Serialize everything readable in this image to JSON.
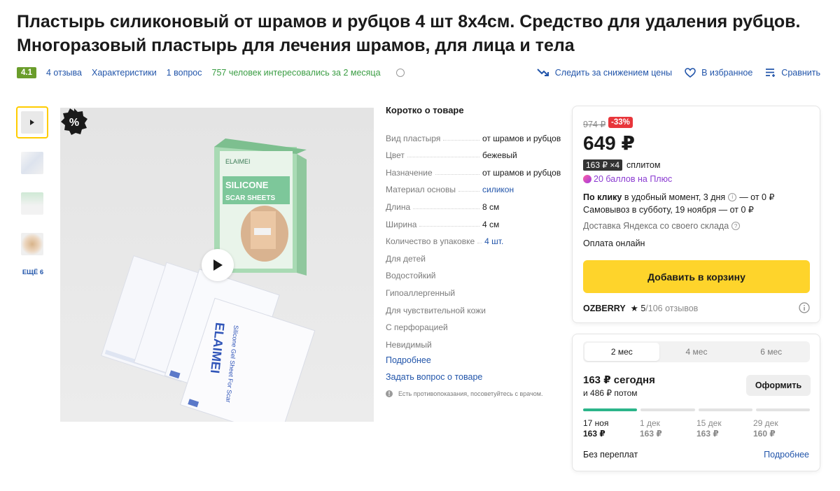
{
  "product": {
    "title": "Пластырь силиконовый от шрамов и рубцов 4 шт 8х4см. Средство для удаления рубцов. Многоразовый пластырь для лечения шрамов, для лица и тела"
  },
  "meta": {
    "rating": "4.1",
    "reviews": "4 отзыва",
    "characteristics": "Характеристики",
    "questions": "1 вопрос",
    "interest": "757 человек интересовались за 2 месяца"
  },
  "actions": {
    "track_price": "Следить за снижением цены",
    "favorite": "В избранное",
    "compare": "Сравнить"
  },
  "gallery": {
    "more": "ЕЩЁ 6",
    "box_brand": "ELAIMEI",
    "box_title_1": "SILICONE",
    "box_title_2": "SCAR SHEETS",
    "packet_brand": "ELAIMEI",
    "packet_text": "Silicone Gel Sheet For Scar",
    "discount_symbol": "%"
  },
  "specs": {
    "title": "Коротко о товаре",
    "rows": [
      {
        "k": "Вид пластыря",
        "v": "от шрамов и рубцов",
        "link": false
      },
      {
        "k": "Цвет",
        "v": "бежевый",
        "link": false
      },
      {
        "k": "Назначение",
        "v": "от шрамов и рубцов",
        "link": false
      },
      {
        "k": "Материал основы",
        "v": "силикон",
        "link": true
      },
      {
        "k": "Длина",
        "v": "8 см",
        "link": false
      },
      {
        "k": "Ширина",
        "v": "4 см",
        "link": false
      },
      {
        "k": "Количество в упаковке",
        "v": "4 шт.",
        "link": true
      },
      {
        "k": "Для детей",
        "v": "",
        "link": false
      },
      {
        "k": "Водостойкий",
        "v": "",
        "link": false
      },
      {
        "k": "Гипоаллергенный",
        "v": "",
        "link": false
      },
      {
        "k": "Для чувствительной кожи",
        "v": "",
        "link": false
      },
      {
        "k": "С перфорацией",
        "v": "",
        "link": false
      },
      {
        "k": "Невидимый",
        "v": "",
        "link": false
      }
    ],
    "more": "Подробнее",
    "ask": "Задать вопрос о товаре",
    "contra": "Есть противопоказания, посоветуйтесь с врачом."
  },
  "offer": {
    "old_price": "974 ₽",
    "discount": "-33%",
    "price": "649 ₽",
    "split_badge": "163 ₽ ×4",
    "split_label": "сплитом",
    "plus": "20 баллов на Плюс",
    "delivery_click_bold": "По клику",
    "delivery_click_rest": "в удобный момент, 3 дня",
    "delivery_click_price": "— от 0 ₽",
    "pickup": "Самовывоз в субботу, 19 ноября",
    "pickup_price": "— от 0 ₽",
    "yandex_delivery": "Доставка Яндекса со своего склада",
    "payment": "Оплата онлайн",
    "cart_button": "Добавить в корзину",
    "seller": "OZBERRY",
    "seller_rating": "★ 5",
    "seller_reviews": "/106 отзывов"
  },
  "split": {
    "tabs": [
      "2 мес",
      "4 мес",
      "6 мес"
    ],
    "today": "163 ₽ сегодня",
    "later": "и 486 ₽ потом",
    "order_button": "Оформить",
    "schedule": [
      {
        "date": "17 ноя",
        "amount": "163 ₽"
      },
      {
        "date": "1 дек",
        "amount": "163 ₽"
      },
      {
        "date": "15 дек",
        "amount": "163 ₽"
      },
      {
        "date": "29 дек",
        "amount": "160 ₽"
      }
    ],
    "no_overpay": "Без переплат",
    "more": "Подробнее"
  },
  "colors": {
    "accent_yellow": "#fed42b",
    "link_blue": "#2255aa",
    "rating_green": "#6a9d2b",
    "discount_red": "#e8363b",
    "split_green": "#2cb58a",
    "plus_purple": "#8a3ad1"
  }
}
